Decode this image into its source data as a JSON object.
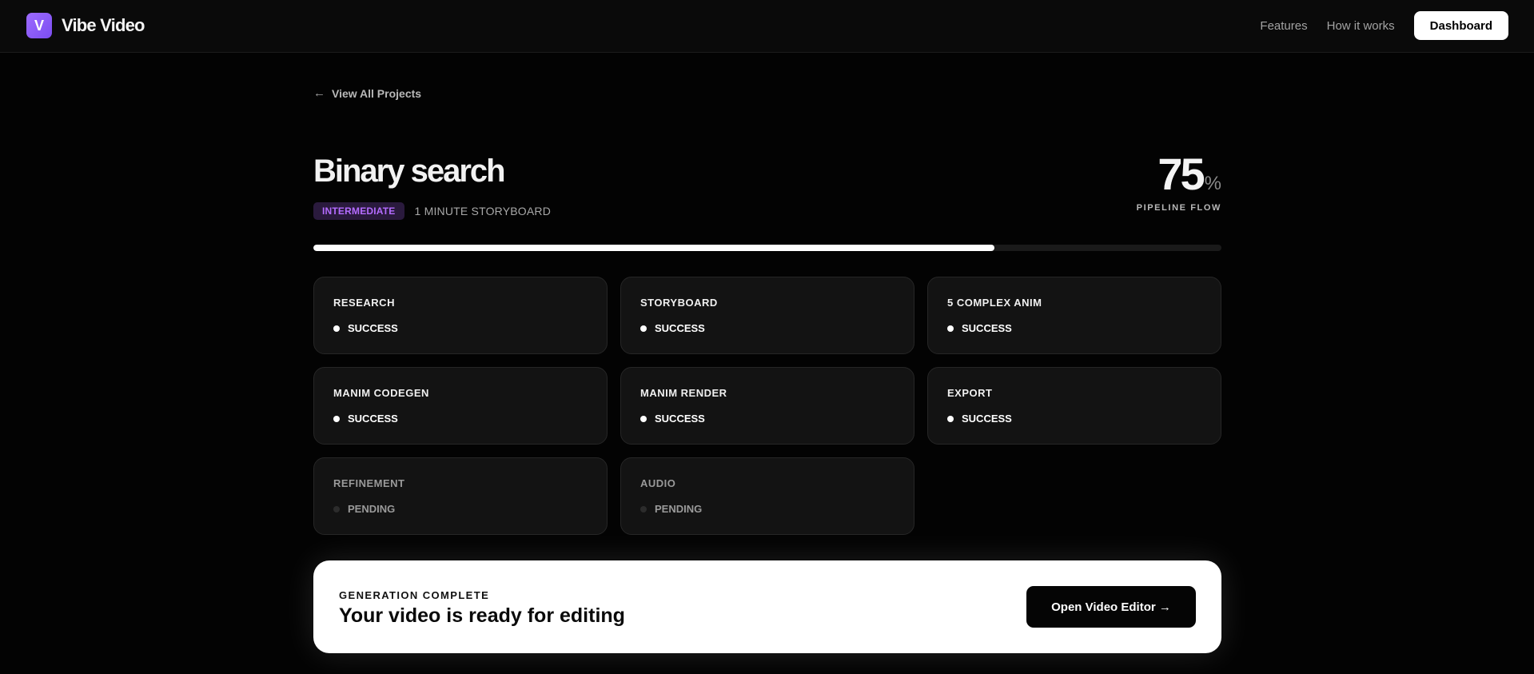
{
  "app": {
    "logo_letter": "V",
    "name": "Vibe Video",
    "brand_color": "#8b5cf6"
  },
  "nav": {
    "features": "Features",
    "how_it_works": "How it works",
    "dashboard": "Dashboard"
  },
  "back": {
    "arrow": "←",
    "label": "View All Projects"
  },
  "project": {
    "title": "Binary search",
    "level": "INTERMEDIATE",
    "duration": "1 MINUTE STORYBOARD"
  },
  "progress": {
    "value": "75",
    "unit": "%",
    "label": "PIPELINE FLOW",
    "fraction": 0.75
  },
  "stages": [
    {
      "name": "RESEARCH",
      "status": "SUCCESS",
      "state": "success"
    },
    {
      "name": "STORYBOARD",
      "status": "SUCCESS",
      "state": "success"
    },
    {
      "name": "5 COMPLEX ANIM",
      "status": "SUCCESS",
      "state": "success"
    },
    {
      "name": "MANIM CODEGEN",
      "status": "SUCCESS",
      "state": "success"
    },
    {
      "name": "MANIM RENDER",
      "status": "SUCCESS",
      "state": "success"
    },
    {
      "name": "EXPORT",
      "status": "SUCCESS",
      "state": "success"
    },
    {
      "name": "REFINEMENT",
      "status": "PENDING",
      "state": "pending"
    },
    {
      "name": "AUDIO",
      "status": "PENDING",
      "state": "pending"
    }
  ],
  "completion": {
    "label": "GENERATION COMPLETE",
    "message": "Your video is ready for editing",
    "button": "Open Video Editor →"
  }
}
